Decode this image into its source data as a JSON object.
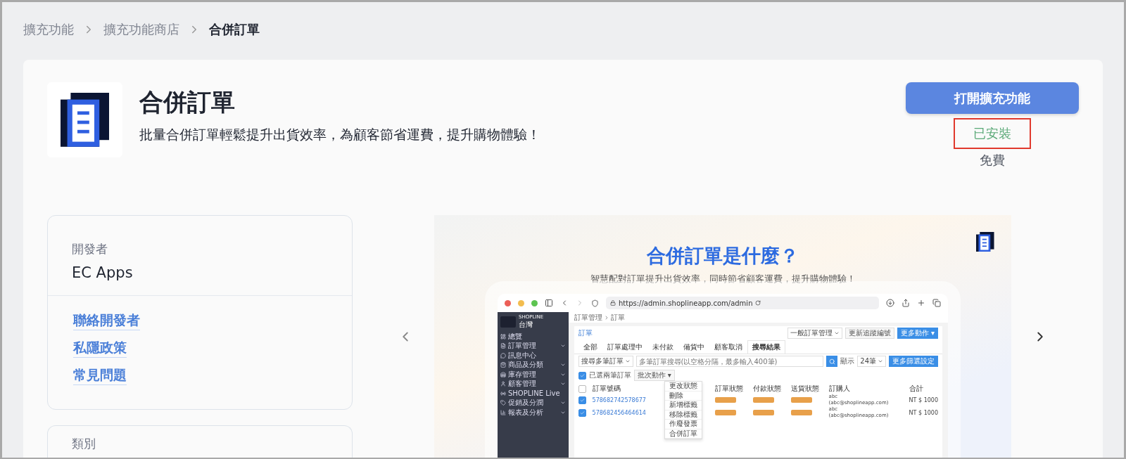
{
  "breadcrumb": [
    {
      "label": "擴充功能",
      "current": false
    },
    {
      "label": "擴充功能商店",
      "current": false
    },
    {
      "label": "合併訂單",
      "current": true
    }
  ],
  "app": {
    "title": "合併訂單",
    "description": "批量合併訂單輕鬆提升出貨效率，為顧客節省運費，提升購物體驗！"
  },
  "actions": {
    "open_button": "打開擴充功能",
    "installed": true,
    "status": "已安裝",
    "price": "免費"
  },
  "developer": {
    "label": "開發者",
    "name": "EC Apps"
  },
  "links": [
    "聯絡開發者",
    "私隱政策",
    "常見問題"
  ],
  "category_card": {
    "label": "類別"
  },
  "carousel": {
    "headline": "合併訂單是什麼？",
    "subtitle": "智慧配對訂單提升出貨效率，同時節省顧客運費，提升購物體驗！",
    "browser": {
      "url": "https://admin.shoplineapp.com/admin",
      "admin": {
        "brand": "SHOPLINE",
        "region": "台灣",
        "nav": [
          {
            "label": "總覽",
            "expandable": false
          },
          {
            "label": "訂單管理",
            "expandable": true
          },
          {
            "label": "訊息中心",
            "expandable": false
          },
          {
            "label": "商品及分類",
            "expandable": true
          },
          {
            "label": "庫存管理",
            "expandable": true
          },
          {
            "label": "顧客管理",
            "expandable": true
          },
          {
            "label": "SHOPLINE Live",
            "expandable": false
          },
          {
            "label": "促銷及分潤",
            "expandable": true
          },
          {
            "label": "報表及分析",
            "expandable": true
          }
        ],
        "breadcrumb": [
          "訂單管理",
          "訂單"
        ],
        "page_title": "訂單",
        "view_select": "一般訂單管理",
        "buttons": [
          "更新追蹤編號",
          "更多動作 ▾"
        ],
        "tabs": [
          {
            "label": "全部",
            "selected": false
          },
          {
            "label": "訂單處理中",
            "selected": false
          },
          {
            "label": "未付款",
            "selected": false
          },
          {
            "label": "備貨中",
            "selected": false
          },
          {
            "label": "顧客取消",
            "selected": false
          },
          {
            "label": "搜尋結果",
            "selected": true
          }
        ],
        "search_type": "搜尋多筆訂單",
        "search_placeholder": "多筆訂單搜尋(以空格分隔，最多輸入400筆)",
        "show_label": "顯示",
        "page_size": "24筆",
        "filter_button": "更多篩選設定",
        "selected_count": "已選兩筆訂單",
        "batch_button": "批次動作 ▾",
        "selection_checked": true,
        "select_all_checked": false,
        "batch_menu": [
          "更改狀態",
          "刪除",
          "新增標籤",
          "移除標籤",
          "作廢發票",
          "合併訂單"
        ],
        "columns": [
          "訂單號碼",
          "訂單狀態",
          "付款狀態",
          "送貨狀態",
          "訂購人",
          "合計"
        ],
        "rows": [
          {
            "order_no": "578682742578677",
            "checked": true,
            "buyer": "abc",
            "email": "(abc@shoplineapp.com)",
            "total": "NT $ 1000"
          },
          {
            "order_no": "578682456464614",
            "checked": true,
            "buyer": "abc",
            "email": "(abc@shoplineapp.com)",
            "total": "NT $ 1000"
          }
        ]
      }
    }
  }
}
